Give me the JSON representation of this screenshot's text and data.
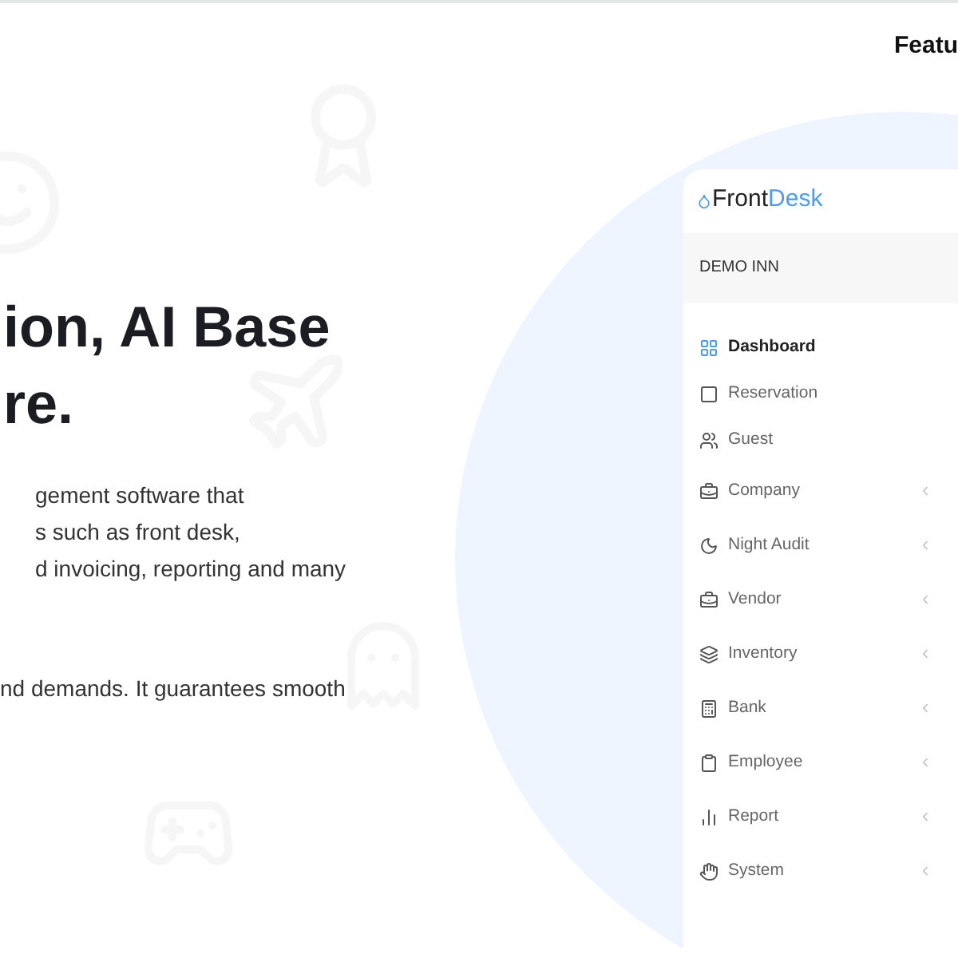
{
  "nav": {
    "label": "Featu"
  },
  "hero": {
    "heading_lines": [
      "ion, AI Base",
      "re."
    ],
    "paragraph_lines": [
      "gement software that",
      "s such as front desk,",
      "d invoicing, reporting and many"
    ],
    "second_paragraph": "nd demands. It guarantees smooth"
  },
  "app": {
    "logo": {
      "part1": "Front",
      "part2": "Desk"
    },
    "property": "DEMO INN",
    "menu": [
      {
        "label": "Dashboard",
        "selected": true,
        "expandable": false
      },
      {
        "label": "Reservation",
        "selected": false,
        "expandable": false
      },
      {
        "label": "Guest",
        "selected": false,
        "expandable": false
      },
      {
        "label": "Company",
        "selected": false,
        "expandable": true
      },
      {
        "label": "Night Audit",
        "selected": false,
        "expandable": true
      },
      {
        "label": "Vendor",
        "selected": false,
        "expandable": true
      },
      {
        "label": "Inventory",
        "selected": false,
        "expandable": true
      },
      {
        "label": "Bank",
        "selected": false,
        "expandable": true
      },
      {
        "label": "Employee",
        "selected": false,
        "expandable": true
      },
      {
        "label": "Report",
        "selected": false,
        "expandable": true
      },
      {
        "label": "System",
        "selected": false,
        "expandable": true
      }
    ]
  }
}
